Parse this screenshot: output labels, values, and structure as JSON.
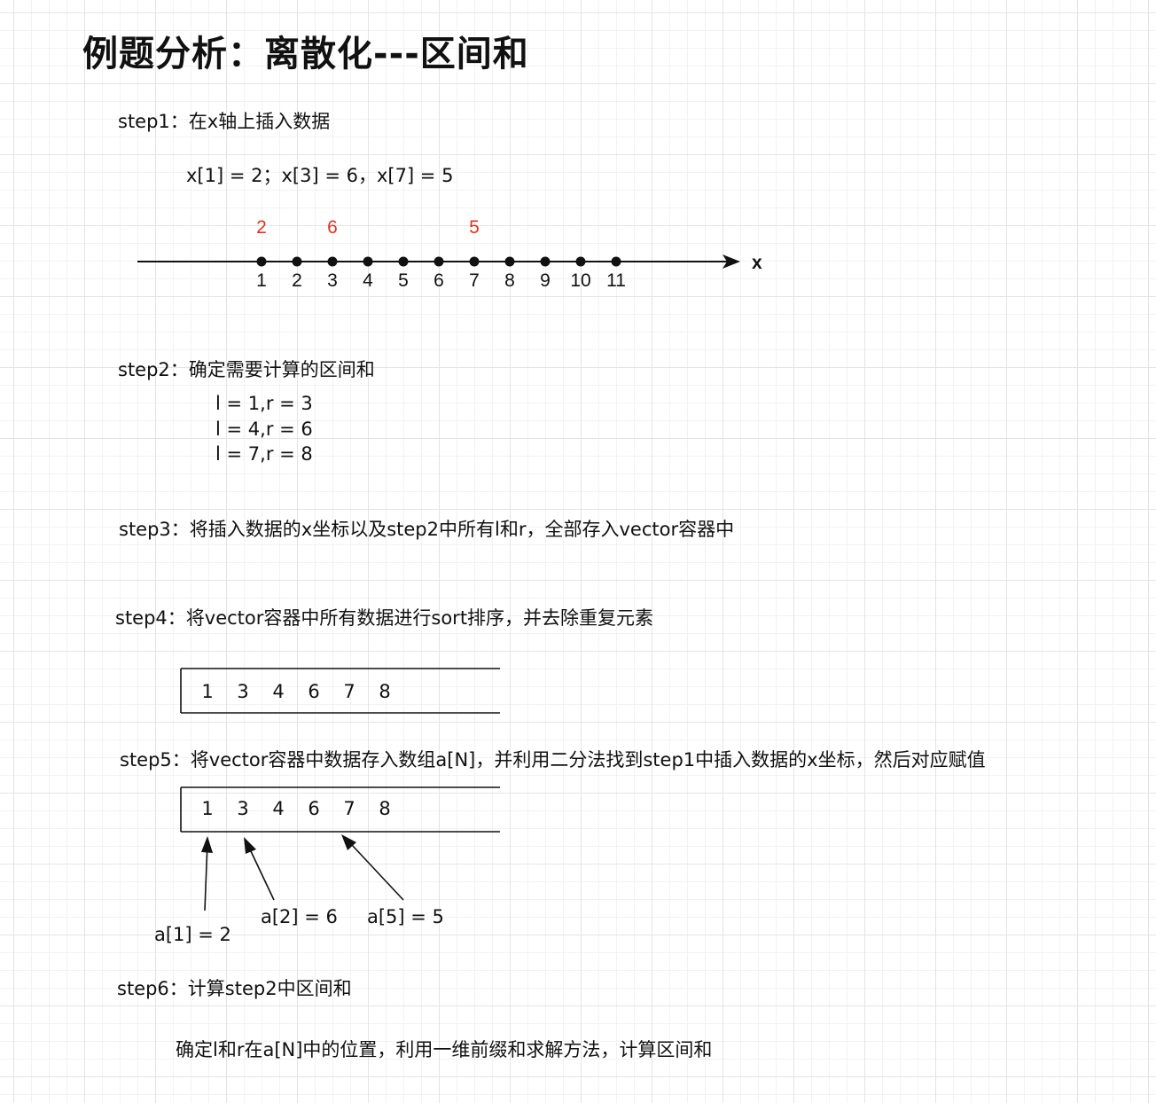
{
  "title": "例题分析：离散化---区间和",
  "step1": {
    "label": "step1：在x轴上插入数据",
    "inserts": "x[1] = 2；x[3] = 6，x[7] = 5"
  },
  "number_line": {
    "axis_label": "x",
    "ticks": [
      "1",
      "2",
      "3",
      "4",
      "5",
      "6",
      "7",
      "8",
      "9",
      "10",
      "11"
    ],
    "inserted_values": [
      {
        "pos": 1,
        "value": "2"
      },
      {
        "pos": 3,
        "value": "6"
      },
      {
        "pos": 7,
        "value": "5"
      }
    ],
    "value_color": "#e0341f"
  },
  "step2": {
    "label": "step2：确定需要计算的区间和",
    "queries": [
      "l = 1,r = 3",
      "l = 4,r = 6",
      "l = 7,r = 8"
    ]
  },
  "step3": {
    "label": "step3：将插入数据的x坐标以及step2中所有l和r，全部存入vector容器中"
  },
  "step4": {
    "label": "step4：将vector容器中所有数据进行sort排序，并去除重复元素",
    "array": [
      "1",
      "3",
      "4",
      "6",
      "7",
      "8"
    ]
  },
  "step5": {
    "label": "step5：将vector容器中数据存入数组a[N]，并利用二分法找到step1中插入数据的x坐标，然后对应赋值",
    "array": [
      "1",
      "3",
      "4",
      "6",
      "7",
      "8"
    ],
    "pointers": [
      "a[1] = 2",
      "a[2] = 6",
      "a[5] = 5"
    ]
  },
  "step6": {
    "label": "step6：计算step2中区间和",
    "desc": "确定l和r在a[N]中的位置，利用一维前缀和求解方法，计算区间和"
  }
}
